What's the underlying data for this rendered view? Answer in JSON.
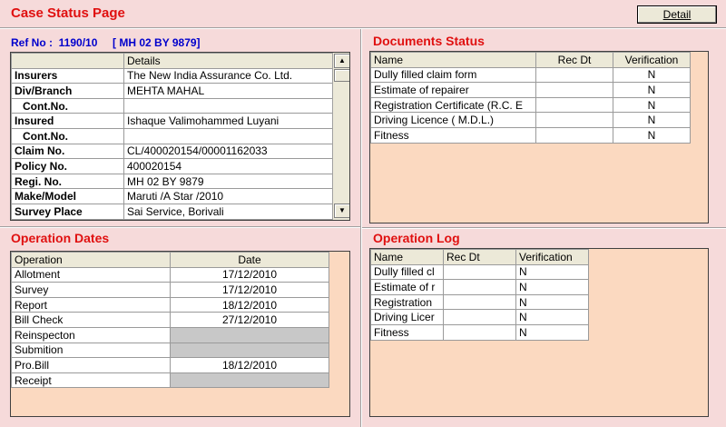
{
  "window": {
    "title": "Case Status Page",
    "detail_button": "Detail"
  },
  "ref": {
    "text": "Ref No :  1190/10     [ MH 02 BY 9879]"
  },
  "details": {
    "header": "Details",
    "rows": [
      {
        "label": "Insurers",
        "value": "The New India Assurance Co. Ltd.",
        "bold": true
      },
      {
        "label": "Div/Branch",
        "value": "MEHTA MAHAL",
        "bold": true
      },
      {
        "label": "Cont.No.",
        "value": "",
        "bold": true,
        "indent": true
      },
      {
        "label": "Insured",
        "value": "Ishaque Valimohammed Luyani",
        "bold": true
      },
      {
        "label": "Cont.No.",
        "value": "",
        "bold": true,
        "indent": true
      },
      {
        "label": "Claim No.",
        "value": "CL/400020154/00001162033",
        "bold": true
      },
      {
        "label": "Policy No.",
        "value": "400020154",
        "bold": true
      },
      {
        "label": "Regi. No.",
        "value": "MH 02 BY 9879",
        "bold": true
      },
      {
        "label": "Make/Model",
        "value": "Maruti /A Star /2010",
        "bold": true
      },
      {
        "label": "Survey Place",
        "value": "Sai Service, Borivali",
        "bold": true
      }
    ]
  },
  "documents_status": {
    "title": "Documents Status",
    "columns": [
      "Name",
      "Rec Dt",
      "Verification"
    ],
    "rows": [
      [
        "Dully filled claim form",
        "",
        "N"
      ],
      [
        "Estimate of repairer",
        "",
        "N"
      ],
      [
        "Registration Certificate (R.C. E",
        "",
        "N"
      ],
      [
        "Driving Licence ( M.D.L.)",
        "",
        "N"
      ],
      [
        "Fitness",
        "",
        "N"
      ]
    ]
  },
  "operation_dates": {
    "title": "Operation Dates",
    "columns": [
      "Operation",
      "Date"
    ],
    "rows": [
      [
        "Allotment",
        "17/12/2010"
      ],
      [
        "Survey",
        "17/12/2010"
      ],
      [
        "Report",
        "18/12/2010"
      ],
      [
        "Bill Check",
        "27/12/2010"
      ],
      [
        "Reinspecton",
        ""
      ],
      [
        "Submition",
        ""
      ],
      [
        "Pro.Bill",
        "18/12/2010"
      ],
      [
        "Receipt",
        ""
      ]
    ]
  },
  "operation_log": {
    "title": "Operation Log",
    "columns": [
      "Name",
      "Rec Dt",
      "Verification"
    ],
    "rows": [
      [
        "Dully filled cl",
        "",
        "N"
      ],
      [
        "Estimate of r",
        "",
        "N"
      ],
      [
        "Registration",
        "",
        "N"
      ],
      [
        "Driving Licer",
        "",
        "N"
      ],
      [
        "Fitness",
        "",
        "N"
      ]
    ]
  },
  "colors": {
    "title_red": "#e01010",
    "ref_blue": "#0000cc",
    "background": "#f6dada",
    "grid_bg": "#fbd9c0"
  }
}
